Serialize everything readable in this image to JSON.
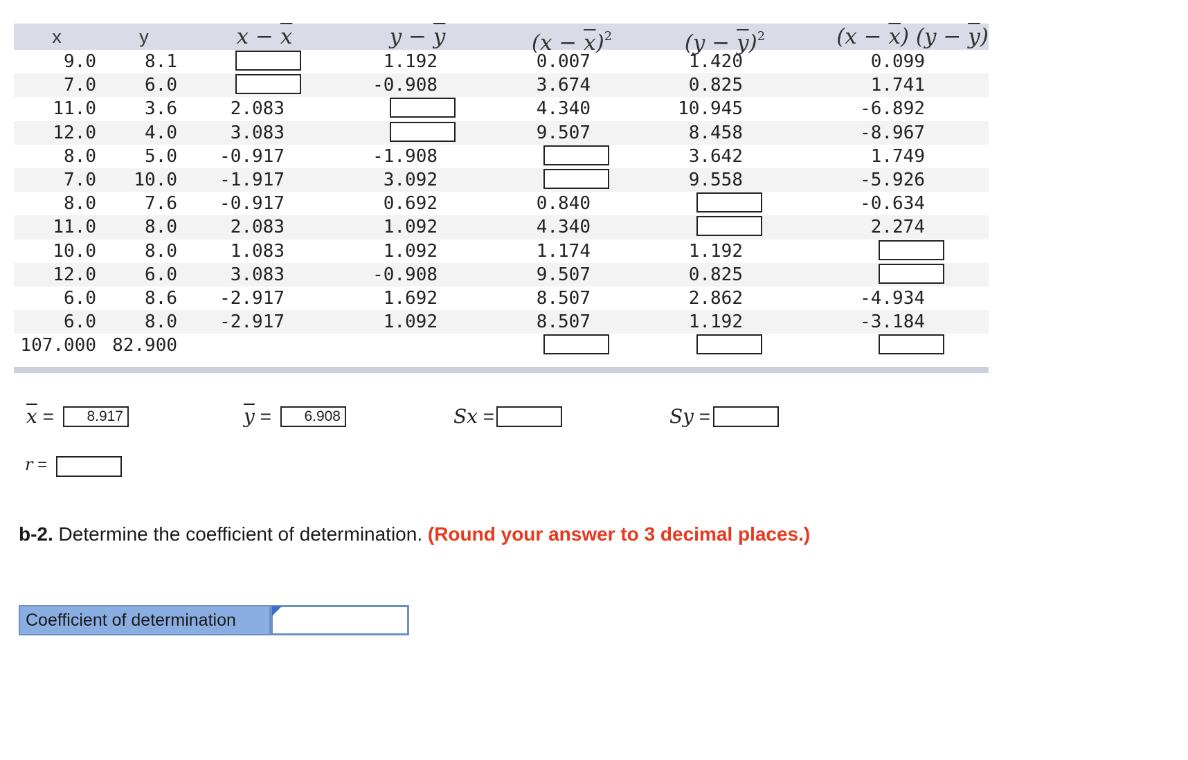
{
  "table": {
    "headers": {
      "x": "x",
      "y": "y",
      "x_dev": "x − x",
      "y_dev": "y − y",
      "x_dev_sq": "(x − x)",
      "y_dev_sq": "(y − y)",
      "xy_prod": "(x − x) (y − y)"
    },
    "rows": [
      {
        "x": "9.0",
        "y": "8.1",
        "x_dev": "",
        "y_dev": "1.192",
        "x_dev_sq": "0.007",
        "y_dev_sq": "1.420",
        "xy_prod": "0.099"
      },
      {
        "x": "7.0",
        "y": "6.0",
        "x_dev": "",
        "y_dev": "-0.908",
        "x_dev_sq": "3.674",
        "y_dev_sq": "0.825",
        "xy_prod": "1.741"
      },
      {
        "x": "11.0",
        "y": "3.6",
        "x_dev": "2.083",
        "y_dev": "",
        "x_dev_sq": "4.340",
        "y_dev_sq": "10.945",
        "xy_prod": "-6.892"
      },
      {
        "x": "12.0",
        "y": "4.0",
        "x_dev": "3.083",
        "y_dev": "",
        "x_dev_sq": "9.507",
        "y_dev_sq": "8.458",
        "xy_prod": "-8.967"
      },
      {
        "x": "8.0",
        "y": "5.0",
        "x_dev": "-0.917",
        "y_dev": "-1.908",
        "x_dev_sq": "",
        "y_dev_sq": "3.642",
        "xy_prod": "1.749"
      },
      {
        "x": "7.0",
        "y": "10.0",
        "x_dev": "-1.917",
        "y_dev": "3.092",
        "x_dev_sq": "",
        "y_dev_sq": "9.558",
        "xy_prod": "-5.926"
      },
      {
        "x": "8.0",
        "y": "7.6",
        "x_dev": "-0.917",
        "y_dev": "0.692",
        "x_dev_sq": "0.840",
        "y_dev_sq": "",
        "xy_prod": "-0.634"
      },
      {
        "x": "11.0",
        "y": "8.0",
        "x_dev": "2.083",
        "y_dev": "1.092",
        "x_dev_sq": "4.340",
        "y_dev_sq": "",
        "xy_prod": "2.274"
      },
      {
        "x": "10.0",
        "y": "8.0",
        "x_dev": "1.083",
        "y_dev": "1.092",
        "x_dev_sq": "1.174",
        "y_dev_sq": "1.192",
        "xy_prod": ""
      },
      {
        "x": "12.0",
        "y": "6.0",
        "x_dev": "3.083",
        "y_dev": "-0.908",
        "x_dev_sq": "9.507",
        "y_dev_sq": "0.825",
        "xy_prod": ""
      },
      {
        "x": "6.0",
        "y": "8.6",
        "x_dev": "-2.917",
        "y_dev": "1.692",
        "x_dev_sq": "8.507",
        "y_dev_sq": "2.862",
        "xy_prod": "-4.934"
      },
      {
        "x": "6.0",
        "y": "8.0",
        "x_dev": "-2.917",
        "y_dev": "1.092",
        "x_dev_sq": "8.507",
        "y_dev_sq": "1.192",
        "xy_prod": "-3.184"
      }
    ],
    "input_cells": [
      [
        0,
        "x_dev"
      ],
      [
        1,
        "x_dev"
      ],
      [
        2,
        "y_dev"
      ],
      [
        3,
        "y_dev"
      ],
      [
        4,
        "x_dev_sq"
      ],
      [
        5,
        "x_dev_sq"
      ],
      [
        6,
        "y_dev_sq"
      ],
      [
        7,
        "y_dev_sq"
      ],
      [
        8,
        "xy_prod"
      ],
      [
        9,
        "xy_prod"
      ]
    ],
    "totals": {
      "x": "107.000",
      "y": "82.900",
      "x_dev_sq": "",
      "y_dev_sq": "",
      "xy_prod": ""
    }
  },
  "stats": {
    "xbar_label": "x",
    "xbar_value": "8.917",
    "ybar_label": "y",
    "ybar_value": "6.908",
    "sx_label": "Sx",
    "sx_value": "",
    "sy_label": "Sy",
    "sy_value": "",
    "r_label": "r",
    "r_value": "",
    "equals": "="
  },
  "question": {
    "part": "b-2.",
    "text": " Determine the coefficient of determination. ",
    "instruction": "(Round your answer to 3 decimal places.)"
  },
  "answer": {
    "label": "Coefficient of determination",
    "value": ""
  }
}
